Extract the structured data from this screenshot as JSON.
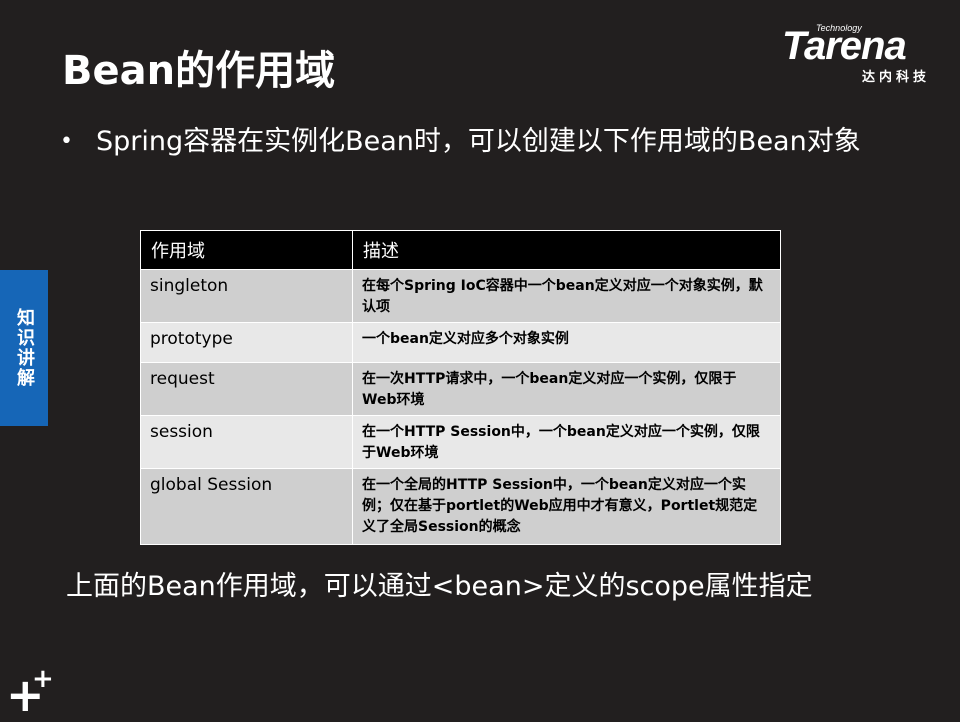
{
  "slide": {
    "title": "Bean的作用域",
    "bullet": "Spring容器在实例化Bean时，可以创建以下作用域的Bean对象",
    "bullet_marker": "•",
    "bottom_text": "上面的Bean作用域，可以通过<bean>定义的scope属性指定"
  },
  "logo": {
    "technology": "Technology",
    "brand": "Tarena",
    "brand_cn": "达内科技"
  },
  "sidetab": {
    "label": "知识讲解",
    "color": "#1666b7"
  },
  "table": {
    "headers": [
      "作用域",
      "描述"
    ],
    "rows": [
      [
        "singleton",
        "在每个Spring IoC容器中一个bean定义对应一个对象实例，默认项"
      ],
      [
        "prototype",
        "一个bean定义对应多个对象实例"
      ],
      [
        "request",
        "在一次HTTP请求中，一个bean定义对应一个实例，仅限于Web环境"
      ],
      [
        "session",
        "在一个HTTP Session中，一个bean定义对应一个实例，仅限于Web环境"
      ],
      [
        "global Session",
        "在一个全局的HTTP Session中，一个bean定义对应一个实例；仅在基于portlet的Web应用中才有意义，Portlet规范定义了全局Session的概念"
      ]
    ]
  },
  "decoration": {
    "plus_big": "+",
    "plus_small": "+"
  },
  "colors": {
    "background": "#221f1f",
    "header_bg": "#000000",
    "row_dark": "#cfcfcf",
    "row_light": "#e8e8e8"
  }
}
